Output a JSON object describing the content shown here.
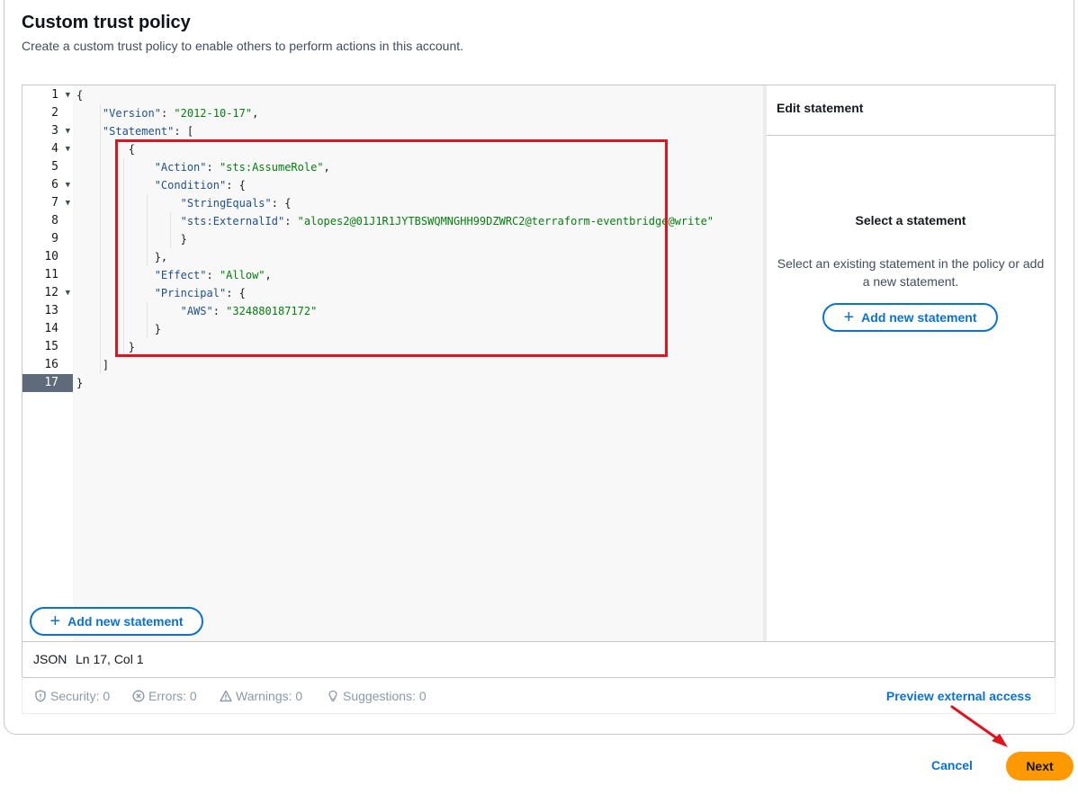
{
  "header": {
    "title": "Custom trust policy",
    "subtitle": "Create a custom trust policy to enable others to perform actions in this account."
  },
  "editor": {
    "lines": [
      {
        "n": "1",
        "fold": true,
        "text": "{"
      },
      {
        "n": "2",
        "fold": false,
        "text": "    \"Version\": \"2012-10-17\","
      },
      {
        "n": "3",
        "fold": true,
        "text": "    \"Statement\": ["
      },
      {
        "n": "4",
        "fold": true,
        "text": "        {"
      },
      {
        "n": "5",
        "fold": false,
        "text": "            \"Action\": \"sts:AssumeRole\","
      },
      {
        "n": "6",
        "fold": true,
        "text": "            \"Condition\": {"
      },
      {
        "n": "7",
        "fold": true,
        "text": "                \"StringEquals\": {"
      },
      {
        "n": "8",
        "fold": false,
        "text": "                \"sts:ExternalId\": \"alopes2@01J1R1JYTBSWQMNGHH99DZWRC2@terraform-eventbridge@write\""
      },
      {
        "n": "9",
        "fold": false,
        "text": "                }"
      },
      {
        "n": "10",
        "fold": false,
        "text": "            },"
      },
      {
        "n": "11",
        "fold": false,
        "text": "            \"Effect\": \"Allow\","
      },
      {
        "n": "12",
        "fold": true,
        "text": "            \"Principal\": {"
      },
      {
        "n": "13",
        "fold": false,
        "text": "                \"AWS\": \"324880187172\""
      },
      {
        "n": "14",
        "fold": false,
        "text": "            }"
      },
      {
        "n": "15",
        "fold": false,
        "text": "        }"
      },
      {
        "n": "16",
        "fold": false,
        "text": "    ]"
      },
      {
        "n": "17",
        "fold": false,
        "text": "}"
      }
    ],
    "active_line": "17",
    "add_statement_label": "Add new statement",
    "status_mode": "JSON",
    "status_position": "Ln 17, Col 1"
  },
  "side_panel": {
    "header": "Edit statement",
    "title": "Select a statement",
    "description": "Select an existing statement in the policy or add a new statement.",
    "add_statement_label": "Add new statement"
  },
  "linter": {
    "security": "Security: 0",
    "errors": "Errors: 0",
    "warnings": "Warnings: 0",
    "suggestions": "Suggestions: 0",
    "preview_link": "Preview external access"
  },
  "footer": {
    "cancel_label": "Cancel",
    "next_label": "Next"
  },
  "colors": {
    "primary": "#0972d3",
    "next_button": "#ff9900",
    "highlight": "#e0141e"
  }
}
